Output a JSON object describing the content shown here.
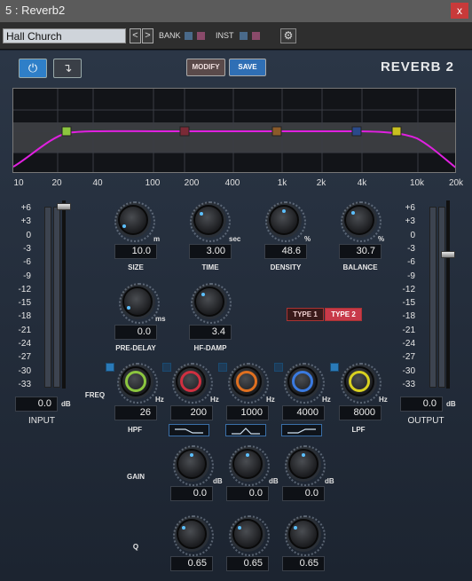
{
  "window": {
    "title": "5 : Reverb2",
    "close_label": "x"
  },
  "presetbar": {
    "preset_name": "Hall Church",
    "prev_label": "<",
    "next_label": ">",
    "bank_label": "BANK",
    "inst_label": "INST",
    "gear_icon": "gear-icon"
  },
  "header": {
    "power_icon": "power-icon",
    "bypass_icon": "routing-arrow-icon",
    "modify_label": "MODIFY",
    "save_label": "SAVE",
    "plugin_title": "REVERB 2"
  },
  "eq_graph": {
    "freq_labels": [
      "10",
      "20",
      "40",
      "100",
      "200",
      "400",
      "1k",
      "2k",
      "4k",
      "10k",
      "20k"
    ],
    "line_color": "#e020e0",
    "node_colors": [
      "#8cc63f",
      "#7a2a36",
      "#8a5a2a",
      "#2a4a8a",
      "#c8c020"
    ]
  },
  "meters": {
    "scale": [
      "+6",
      "+3",
      "0",
      "-3",
      "-6",
      "-9",
      "-12",
      "-15",
      "-18",
      "-21",
      "-24",
      "-27",
      "-30",
      "-33"
    ],
    "input": {
      "value": "0.0",
      "unit": "dB",
      "label": "INPUT"
    },
    "output": {
      "value": "0.0",
      "unit": "dB",
      "label": "OUTPUT"
    }
  },
  "params": {
    "size": {
      "value": "10.0",
      "unit": "m",
      "label": "SIZE"
    },
    "time": {
      "value": "3.00",
      "unit": "sec",
      "label": "TIME"
    },
    "density": {
      "value": "48.6",
      "unit": "%",
      "label": "DENSITY"
    },
    "balance": {
      "value": "30.7",
      "unit": "%",
      "label": "BALANCE"
    },
    "predelay": {
      "value": "0.0",
      "unit": "ms",
      "label": "PRE-DELAY"
    },
    "hfdamp": {
      "value": "3.4",
      "label": "HF-DAMP"
    },
    "type1_label": "TYPE 1",
    "type2_label": "TYPE 2"
  },
  "eq_section": {
    "freq_label": "FREQ",
    "gain_label": "GAIN",
    "q_label": "Q",
    "hpf_label": "HPF",
    "lpf_label": "LPF",
    "hz": "Hz",
    "db": "dB",
    "freqs": [
      "26",
      "200",
      "1000",
      "4000",
      "8000"
    ],
    "gains": [
      "0.0",
      "0.0",
      "0.0"
    ],
    "qs": [
      "0.65",
      "0.65",
      "0.65"
    ]
  }
}
